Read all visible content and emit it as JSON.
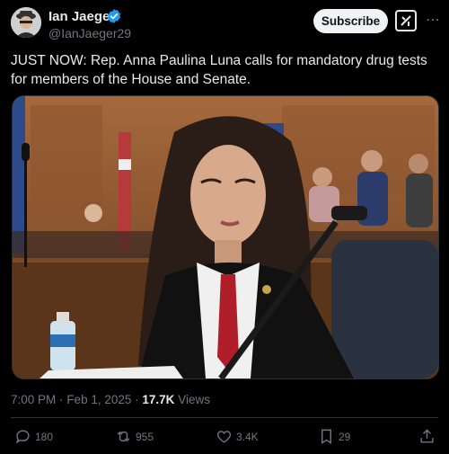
{
  "author": {
    "name": "Ian Jaeger",
    "handle": "@IanJaeger29",
    "verified_color": "#1d9bf0"
  },
  "subscribe_label": "Subscribe",
  "grok_icon": "grok-icon",
  "tweet_text": "JUST NOW: Rep. Anna Paulina Luna calls for mandatory drug tests for members of the House and Senate.",
  "media": {
    "description_icon": "photo"
  },
  "meta": {
    "time": "7:00 PM",
    "separator": "·",
    "date": "Feb 1, 2025",
    "views_count": "17.7K",
    "views_label": "Views"
  },
  "actions": {
    "replies": "180",
    "reposts": "955",
    "likes": "3.4K",
    "bookmarks": "29"
  }
}
